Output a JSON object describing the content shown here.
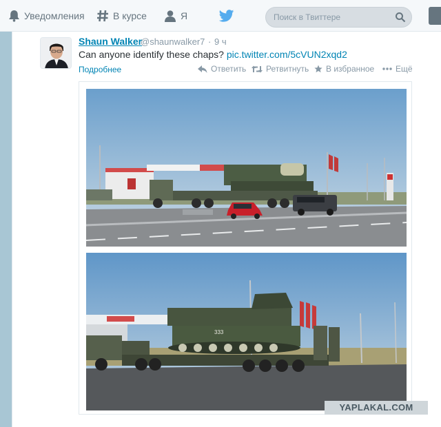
{
  "nav": {
    "notifications": "Уведомления",
    "discover": "В курсе",
    "me": "Я"
  },
  "search": {
    "placeholder": "Поиск в Твиттере"
  },
  "tweet": {
    "author_name": "Shaun Walker",
    "author_handle": "@shaunwalker7",
    "separator": "·",
    "time": "9 ч",
    "text": "Can anyone identify these chaps? ",
    "link": "pic.twitter.com/5cVUN2xqd2",
    "expand": "Подробнее",
    "actions": {
      "reply": "Ответить",
      "retweet": "Ретвитнуть",
      "favorite": "В избранное",
      "more": "Ещё"
    },
    "photo1_truck_number": "",
    "photo2_tank_number": "333"
  },
  "watermark": "YAPLAKAL.COM",
  "icons": {
    "notifications": "bell-icon",
    "discover": "hashtag-icon",
    "me": "person-icon",
    "logo": "twitter-bird-icon",
    "search": "search-icon",
    "reply": "reply-icon",
    "retweet": "retweet-icon",
    "favorite": "star-icon",
    "more": "more-dots-icon"
  },
  "colors": {
    "link": "#0084b4",
    "muted": "#8899a6",
    "text": "#292f33",
    "bird": "#55acee",
    "background": "#c5dbe6"
  }
}
